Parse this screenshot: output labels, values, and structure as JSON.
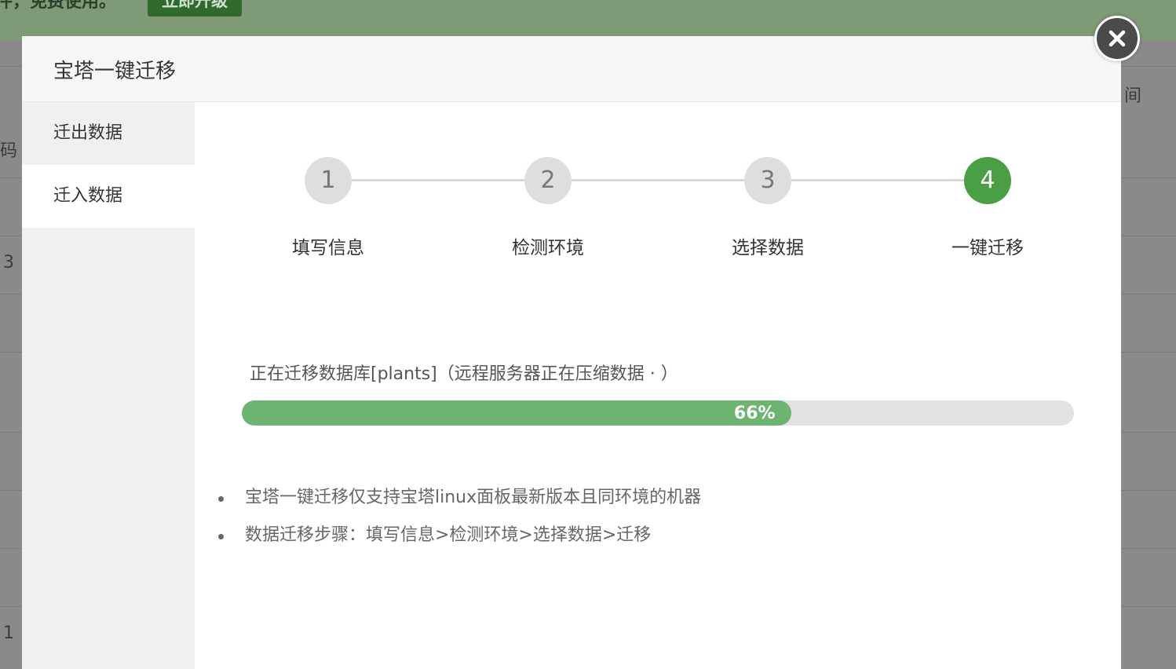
{
  "background": {
    "banner_text": "件，免费使用。",
    "upgrade_button": "立即升级",
    "cells": [
      "码",
      "3",
      "1",
      "间"
    ]
  },
  "modal": {
    "title": "宝塔一键迁移",
    "close_icon": "close-icon",
    "sidebar": {
      "items": [
        {
          "label": "迁出数据",
          "active": false
        },
        {
          "label": "迁入数据",
          "active": true
        }
      ]
    },
    "steps": [
      {
        "number": "1",
        "label": "填写信息",
        "done": false
      },
      {
        "number": "2",
        "label": "检测环境",
        "done": false
      },
      {
        "number": "3",
        "label": "选择数据",
        "done": false
      },
      {
        "number": "4",
        "label": "一键迁移",
        "done": true
      }
    ],
    "status": "正在迁移数据库[plants]（远程服务器正在压缩数据 ·   ）",
    "progress": {
      "percent": 66,
      "label": "66%"
    },
    "notes": [
      "宝塔一键迁移仅支持宝塔linux面板最新版本且同环境的机器",
      "数据迁移步骤：填写信息>检测环境>选择数据>迁移"
    ],
    "colors": {
      "accent": "#4a9e44",
      "progress": "#6db471",
      "track": "#e2e2e2"
    }
  }
}
